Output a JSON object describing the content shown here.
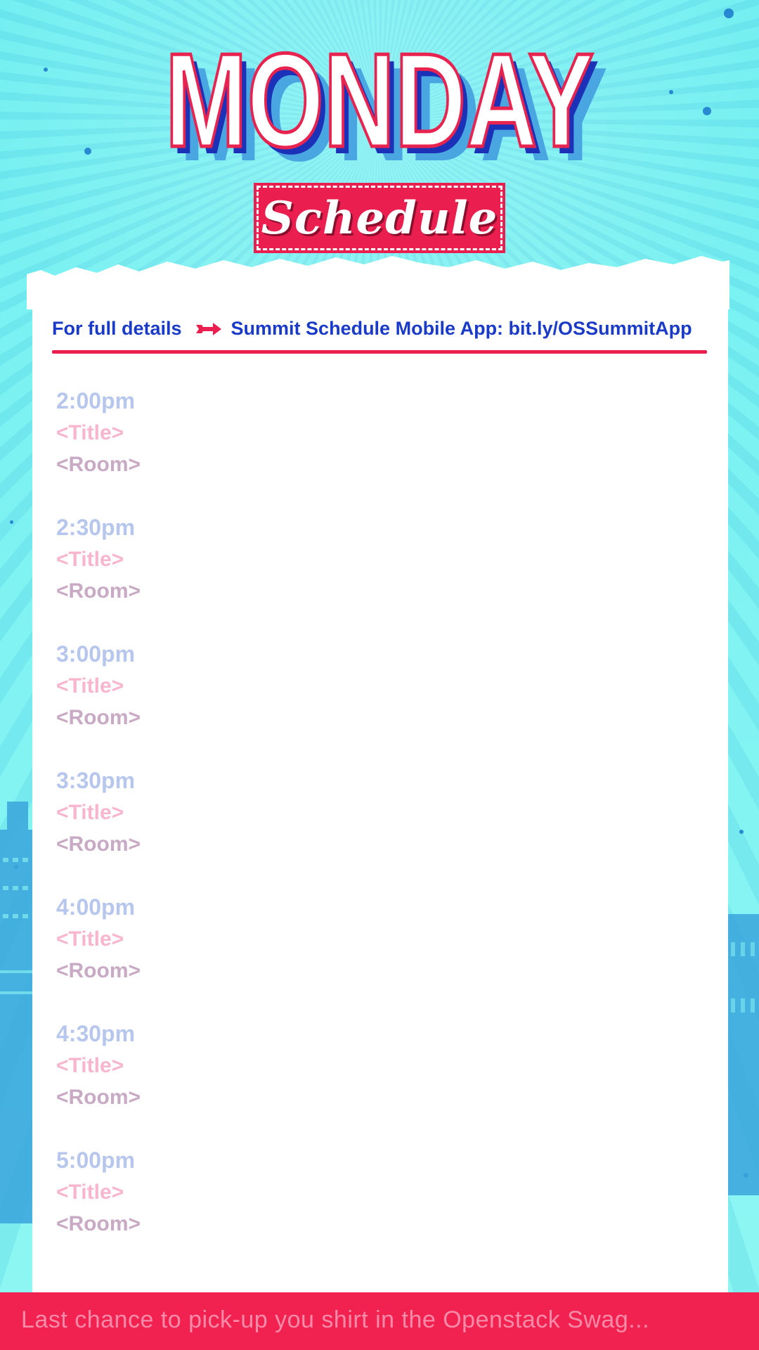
{
  "header": {
    "day": "MONDAY",
    "subtitle": "Schedule"
  },
  "details_bar": {
    "lead": "For full details",
    "arrow_icon": "arrow-right-icon",
    "link_text": "Summit Schedule Mobile App: bit.ly/OSSummitApp"
  },
  "sessions": [
    {
      "time": "2:00pm",
      "title": "<Title>",
      "room": "<Room>"
    },
    {
      "time": "2:30pm",
      "title": "<Title>",
      "room": "<Room>"
    },
    {
      "time": "3:00pm",
      "title": "<Title>",
      "room": "<Room>"
    },
    {
      "time": "3:30pm",
      "title": "<Title>",
      "room": "<Room>"
    },
    {
      "time": "4:00pm",
      "title": "<Title>",
      "room": "<Room>"
    },
    {
      "time": "4:30pm",
      "title": "<Title>",
      "room": "<Room>"
    },
    {
      "time": "5:00pm",
      "title": "<Title>",
      "room": "<Room>"
    }
  ],
  "footer": {
    "ticker": "Last chance to pick-up you shirt in the Openstack Swag..."
  },
  "colors": {
    "background": "#7ef2f0",
    "accent_red": "#ea1f4f",
    "deep_blue": "#1a3ac8",
    "time_color": "#b7c6ec",
    "title_color": "#f7b6cd",
    "room_color": "#c8aac4"
  }
}
